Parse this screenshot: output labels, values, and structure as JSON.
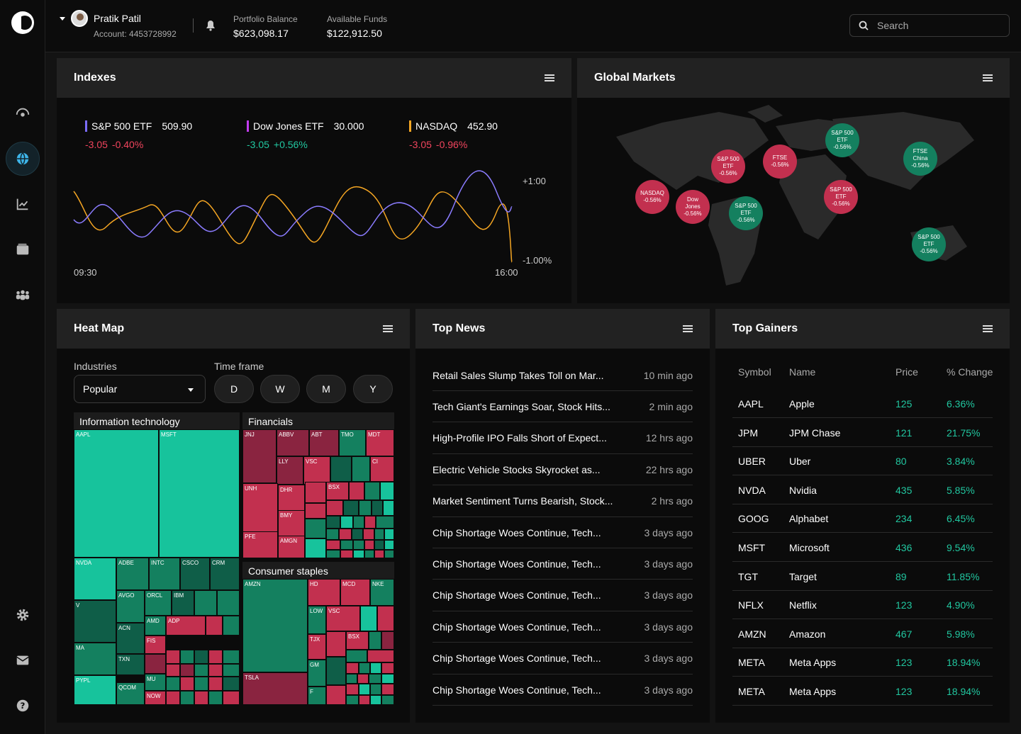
{
  "user": {
    "name": "Pratik Patil",
    "account": "Account: 4453728992"
  },
  "balances": [
    {
      "label": "Portfolio Balance",
      "value": "$623,098.17"
    },
    {
      "label": "Available Funds",
      "value": "$122,912.50"
    }
  ],
  "search": {
    "placeholder": "Search"
  },
  "nav": [
    "eye-icon",
    "globe-icon",
    "chart-icon",
    "wallet-icon",
    "people-icon",
    "gear-icon",
    "mail-icon",
    "help-icon"
  ],
  "indexes": {
    "title": "Indexes",
    "items": [
      {
        "name": "S&P 500 ETF",
        "value": "509.90",
        "change": "-3.05",
        "pct": "-0.40%",
        "color": "#7b6cff",
        "dir": "red"
      },
      {
        "name": "Dow Jones ETF",
        "value": "30.000",
        "change": "-3.05",
        "pct": "+0.56%",
        "color": "#c23cf0",
        "dir": "grn"
      },
      {
        "name": "NASDAQ",
        "value": "452.90",
        "change": "-3.05",
        "pct": "-0.96%",
        "color": "#f5a623",
        "dir": "red"
      }
    ],
    "chart": {
      "y_top": "+1:00",
      "y_bottom": "-1.00%",
      "x_start": "09:30",
      "x_end": "16:00"
    }
  },
  "global": {
    "title": "Global Markets",
    "markers": [
      {
        "l1": "NASDAQ",
        "l2": "",
        "pct": "-0.56%",
        "c": "red"
      },
      {
        "l1": "Dow",
        "l2": "Jones",
        "pct": "-0.56%",
        "c": "red"
      },
      {
        "l1": "S&P 500",
        "l2": "ETF",
        "pct": "-0.56%",
        "c": "red"
      },
      {
        "l1": "S&P 500",
        "l2": "ETF",
        "pct": "-0.56%",
        "c": "grn"
      },
      {
        "l1": "FTSE",
        "l2": "",
        "pct": "-0.56%",
        "c": "red"
      },
      {
        "l1": "S&P 500",
        "l2": "ETF",
        "pct": "-0.56%",
        "c": "grn"
      },
      {
        "l1": "S&P 500",
        "l2": "ETF",
        "pct": "-0.56%",
        "c": "red"
      },
      {
        "l1": "FTSE",
        "l2": "China",
        "pct": "-0.56%",
        "c": "grn"
      },
      {
        "l1": "S&P 500",
        "l2": "ETF",
        "pct": "-0.56%",
        "c": "grn"
      }
    ]
  },
  "heatmap": {
    "title": "Heat Map",
    "industries_label": "Industries",
    "industry": "Popular",
    "timeframe_label": "Time frame",
    "timeframes": [
      "D",
      "W",
      "M",
      "Y"
    ],
    "groups": [
      "Information technology",
      "Financials",
      "Consumer staples"
    ],
    "tiles": [
      "AAPL",
      "MSFT",
      "NVDA",
      "ADBE",
      "INTC",
      "CSCO",
      "CRM",
      "AVGO",
      "ORCL",
      "IBM",
      "V",
      "ACN",
      "AMD",
      "ADP",
      "FIS",
      "MA",
      "TXN",
      "MU",
      "PYPL",
      "QCOM",
      "NOW",
      "JNJ",
      "ABBV",
      "ABT",
      "TMO",
      "MDT",
      "LLY",
      "VSC",
      "CI",
      "UNH",
      "DHR",
      "BSX",
      "BMY",
      "PFE",
      "AMGN",
      "AMZN",
      "HD",
      "MCD",
      "NKE",
      "LOW",
      "VSC",
      "TJX",
      "BSX",
      "GM",
      "TSLA",
      "F"
    ]
  },
  "news": {
    "title": "Top News",
    "items": [
      {
        "t": "Retail Sales Slump Takes Toll on Mar...",
        "time": "10 min ago"
      },
      {
        "t": "Tech Giant's Earnings Soar, Stock Hits...",
        "time": "2 min ago"
      },
      {
        "t": "High-Profile IPO Falls Short of Expect...",
        "time": "12 hrs ago"
      },
      {
        "t": "Electric Vehicle Stocks Skyrocket as...",
        "time": "22 hrs ago"
      },
      {
        "t": "Market Sentiment Turns Bearish, Stock...",
        "time": "2 hrs ago"
      },
      {
        "t": "Chip Shortage Woes Continue, Tech...",
        "time": "3 days ago"
      },
      {
        "t": "Chip Shortage Woes Continue, Tech...",
        "time": "3 days ago"
      },
      {
        "t": "Chip Shortage Woes Continue, Tech...",
        "time": "3 days ago"
      },
      {
        "t": "Chip Shortage Woes Continue, Tech...",
        "time": "3 days ago"
      },
      {
        "t": "Chip Shortage Woes Continue, Tech...",
        "time": "3 days ago"
      },
      {
        "t": "Chip Shortage Woes Continue, Tech...",
        "time": "3 days ago"
      }
    ]
  },
  "gainers": {
    "title": "Top Gainers",
    "headers": [
      "Symbol",
      "Name",
      "Price",
      "% Change"
    ],
    "rows": [
      {
        "s": "AAPL",
        "n": "Apple",
        "p": "125",
        "c": "6.36%"
      },
      {
        "s": "JPM",
        "n": "JPM Chase",
        "p": "121",
        "c": "21.75%"
      },
      {
        "s": "UBER",
        "n": "Uber",
        "p": "80",
        "c": "3.84%"
      },
      {
        "s": "NVDA",
        "n": "Nvidia",
        "p": "435",
        "c": "5.85%"
      },
      {
        "s": "GOOG",
        "n": "Alphabet",
        "p": "234",
        "c": "6.45%"
      },
      {
        "s": "MSFT",
        "n": "Microsoft",
        "p": "436",
        "c": "9.54%"
      },
      {
        "s": "TGT",
        "n": "Target",
        "p": "89",
        "c": "11.85%"
      },
      {
        "s": "NFLX",
        "n": "Netflix",
        "p": "123",
        "c": "4.90%"
      },
      {
        "s": "AMZN",
        "n": "Amazon",
        "p": "467",
        "c": "5.98%"
      },
      {
        "s": "META",
        "n": "Meta Apps",
        "p": "123",
        "c": "18.94%"
      },
      {
        "s": "META",
        "n": "Meta Apps",
        "p": "123",
        "c": "18.94%"
      }
    ]
  },
  "colors": {
    "red": "#c2304f",
    "green": "#14805f",
    "teal": "#17c39c"
  }
}
